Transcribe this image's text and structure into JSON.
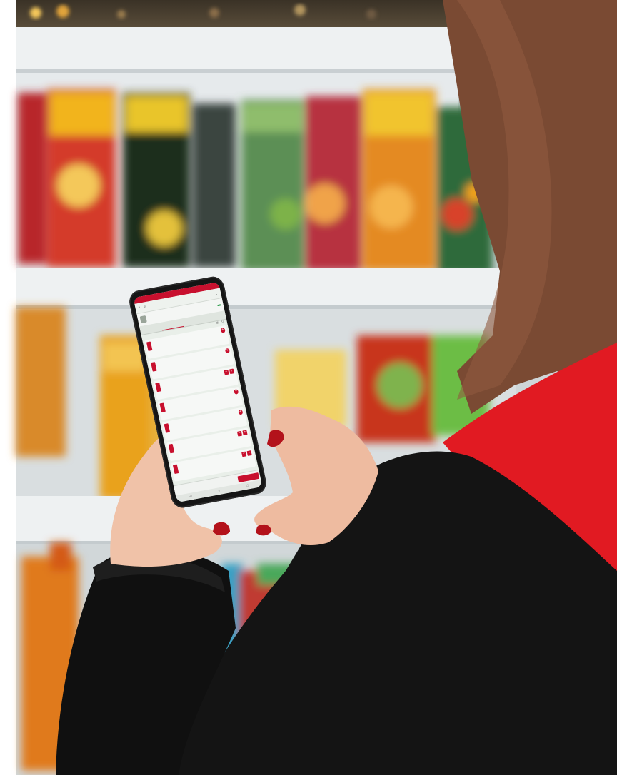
{
  "scene": {
    "palette": {
      "fridge_frame": "#dfe3e4",
      "shelf": "#eef1f2",
      "jacket": "#141414",
      "vest": "#e11a22",
      "hair": "#7a4a33",
      "skin": "#f0c2a8",
      "nail": "#b3121b"
    }
  },
  "phone": {
    "statusbar": {
      "time": "",
      "battery": ""
    },
    "appbar": {
      "title": ""
    },
    "store": {
      "line1": "",
      "line2": "",
      "badge": ""
    },
    "tabs": [
      "",
      "",
      "",
      ""
    ],
    "products": [
      {
        "name": "",
        "price": "",
        "stock": ""
      },
      {
        "name": "",
        "price": "",
        "stock": ""
      },
      {
        "name": "",
        "price": "",
        "stock": ""
      },
      {
        "name": "",
        "price": "",
        "stock": ""
      },
      {
        "name": "",
        "price": "",
        "stock": ""
      },
      {
        "name": "",
        "price": "",
        "stock": ""
      },
      {
        "name": "",
        "price": "",
        "stock": ""
      }
    ],
    "bottom_actions": [
      "",
      "",
      "",
      ""
    ]
  }
}
